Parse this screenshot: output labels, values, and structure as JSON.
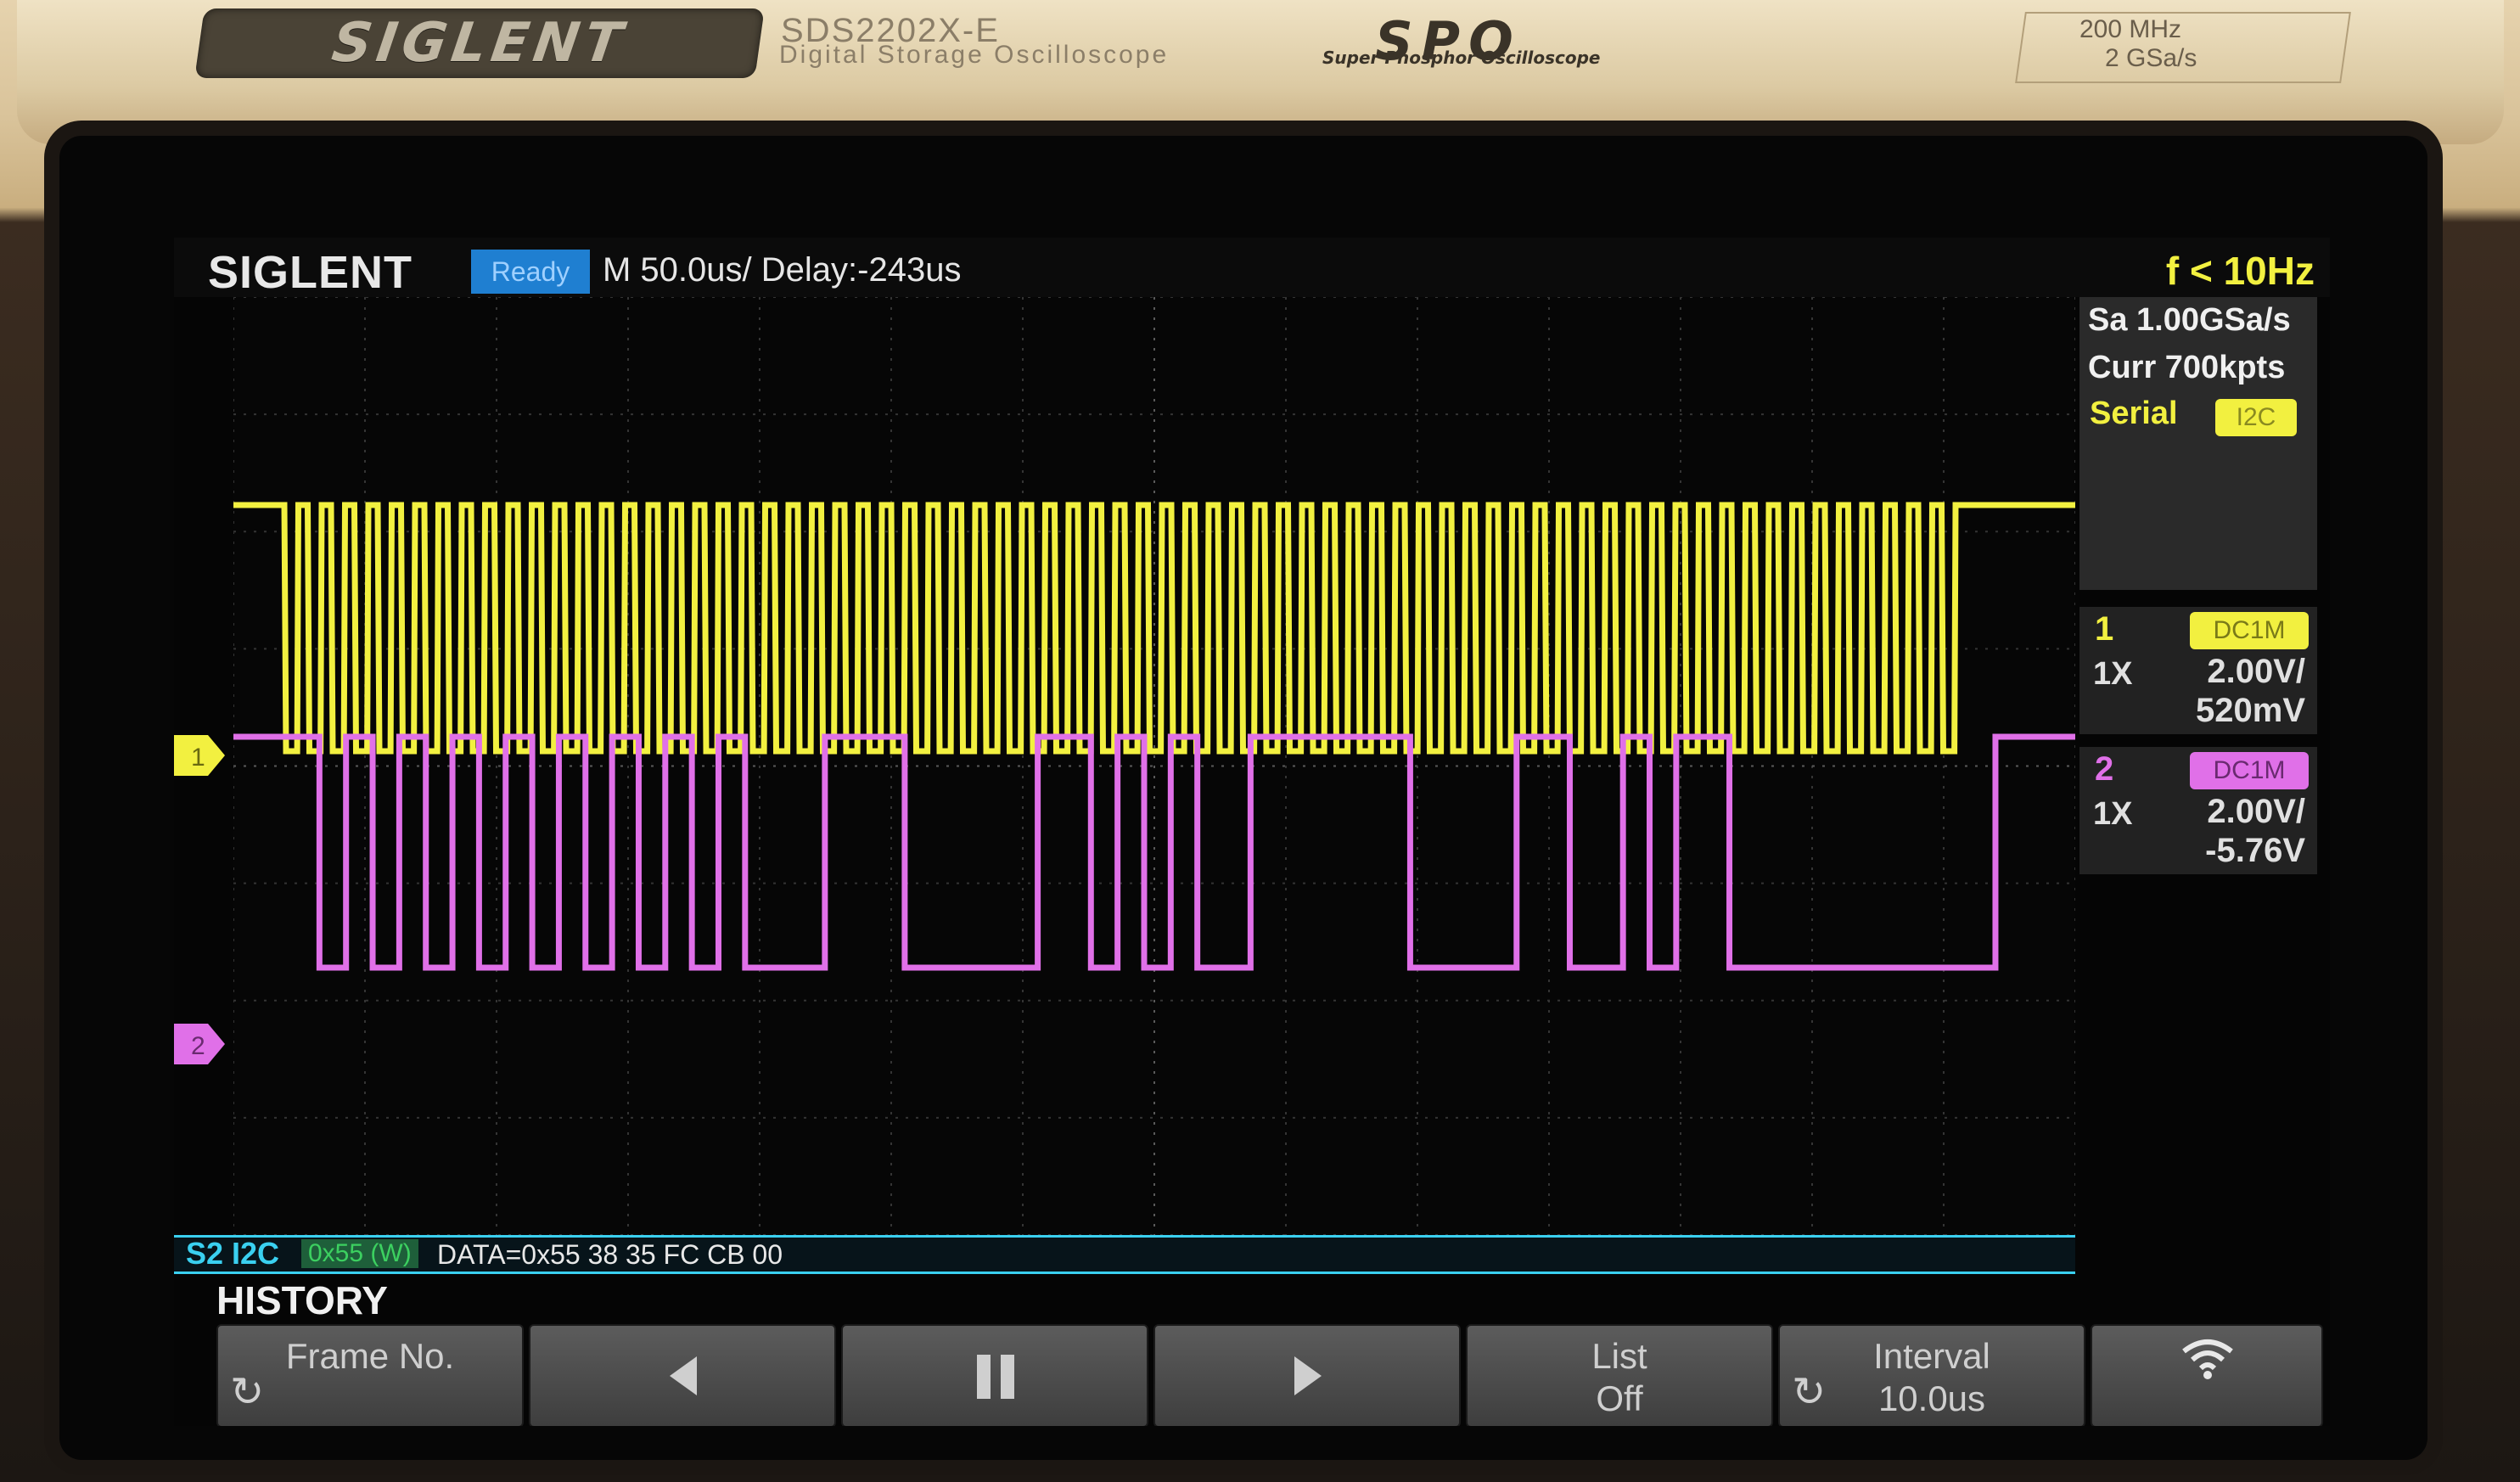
{
  "bezel": {
    "brand": "SIGLENT",
    "model": "SDS2202X-E",
    "model_subtitle": "Digital Storage Oscilloscope",
    "spo": "SPO",
    "spo_subtitle": "Super Phosphor Oscilloscope",
    "spec_bandwidth": "200 MHz",
    "spec_samplerate": "2 GSa/s"
  },
  "status": {
    "brand": "SIGLENT",
    "run_state": "Ready",
    "timebase": "M 50.0us/  Delay:-243us",
    "frequency": "f < 10Hz"
  },
  "info": {
    "sample_rate": "Sa 1.00GSa/s",
    "memory": "Curr 700kpts",
    "serial_label": "Serial",
    "serial_protocol": "I2C"
  },
  "channels": [
    {
      "num": "1",
      "coupling": "DC1M",
      "probe": "1X",
      "scale": "2.00V/",
      "offset": "520mV",
      "color": "#f2f040"
    },
    {
      "num": "2",
      "coupling": "DC1M",
      "probe": "1X",
      "scale": "2.00V/",
      "offset": "-5.76V",
      "color": "#e070e8"
    }
  ],
  "markers": {
    "ch1": "1",
    "ch2": "2"
  },
  "decode": {
    "channel": "S2 I2C",
    "address": "0x55 (W)",
    "data": "DATA=0x55 38 35 FC CB 00"
  },
  "history": {
    "label": "HISTORY"
  },
  "softkeys": [
    {
      "line1": "Frame No.",
      "line2": ""
    },
    {
      "line1": "",
      "line2": ""
    },
    {
      "line1": "",
      "line2": ""
    },
    {
      "line1": "",
      "line2": ""
    },
    {
      "line1": "List",
      "line2": "Off"
    },
    {
      "line1": "Interval",
      "line2": "10.0us"
    },
    {
      "line1": "",
      "line2": ""
    }
  ],
  "icons": {
    "rotate": "rotate-knob-icon",
    "prev": "triangle-left-icon",
    "pause": "pause-icon",
    "next": "triangle-right-icon",
    "wifi": "wifi-icon"
  },
  "colors": {
    "ch1": "#f2f040",
    "ch2": "#e070e8",
    "decode": "#3ad0f0",
    "ready": "#1f7fd1"
  }
}
